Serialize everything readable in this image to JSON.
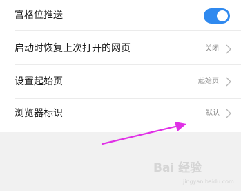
{
  "settings": {
    "items": [
      {
        "label": "宫格位推送",
        "value": "",
        "toggle_on": true
      },
      {
        "label": "启动时恢复上次打开的网页",
        "value": "关闭"
      },
      {
        "label": "设置起始页",
        "value": "起始页"
      },
      {
        "label": "浏览器标识",
        "value": "默认"
      }
    ]
  },
  "annotation": {
    "arrow_color": "#e030e6"
  },
  "watermark": {
    "text": "Bai 经验",
    "sub_text": "jingyan.baidu.com"
  },
  "colors": {
    "toggle_on": "#2f89ef",
    "list_bg": "#ffffff",
    "page_bg": "#f1f1f1"
  }
}
